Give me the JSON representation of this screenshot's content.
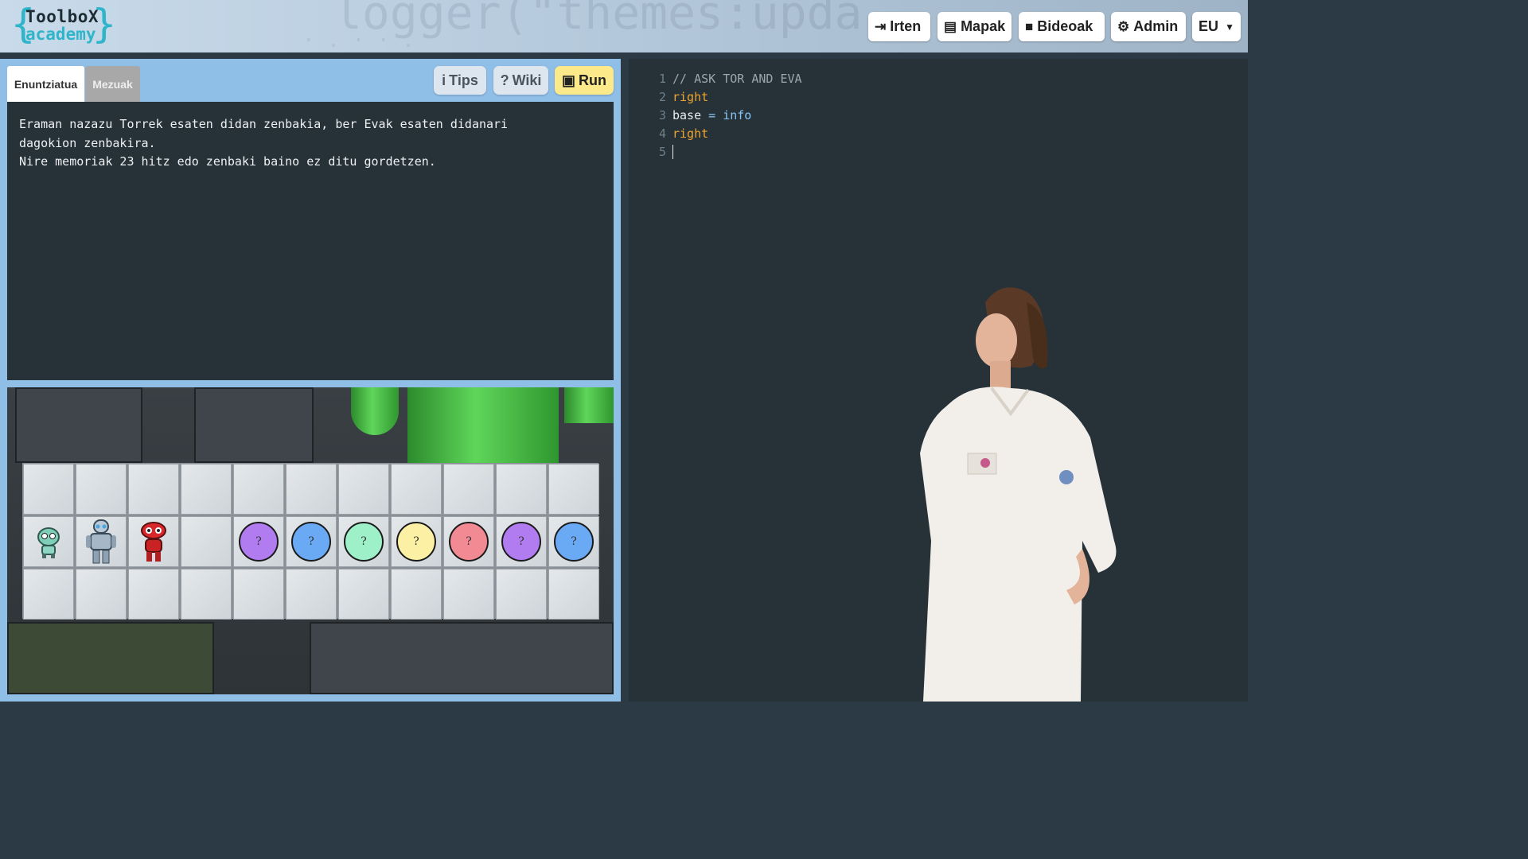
{
  "header": {
    "logo_line1": "ToolboX",
    "logo_line2": "academy",
    "nav": [
      {
        "label": "Irten",
        "icon": "sign-out-icon"
      },
      {
        "label": "Mapak",
        "icon": "table-icon"
      },
      {
        "label": "Bideoak",
        "icon": "video-camera-icon"
      },
      {
        "label": "Admin",
        "icon": "gear-icon"
      }
    ],
    "language": "EU"
  },
  "tabs": {
    "statement": "Enuntziatua",
    "messages": "Mezuak"
  },
  "actions": {
    "tips": "Tips",
    "wiki": "Wiki",
    "run": "Run"
  },
  "statement": {
    "lines": [
      "Eraman nazazu Torrek esaten didan zenbakia, ber Evak esaten didanari\ndagokion zenbakira.",
      "Nire memoriak 23 hitz edo zenbaki baino ez ditu gordetzen."
    ]
  },
  "game": {
    "orbs": [
      {
        "label": "?",
        "color": "#b07cf0"
      },
      {
        "label": "?",
        "color": "#6aa9f4"
      },
      {
        "label": "?",
        "color": "#9df0c8"
      },
      {
        "label": "?",
        "color": "#fbf0a3"
      },
      {
        "label": "?",
        "color": "#f28a94"
      },
      {
        "label": "?",
        "color": "#b07cf0"
      },
      {
        "label": "?",
        "color": "#6aa9f4"
      }
    ]
  },
  "editor": {
    "lines": [
      {
        "n": "1",
        "text": "// ASK TOR AND EVA"
      },
      {
        "n": "2",
        "text": "right"
      },
      {
        "n": "3",
        "var": "base",
        "op": " = ",
        "val": "info"
      },
      {
        "n": "4",
        "text": "right"
      },
      {
        "n": "5",
        "text": ""
      }
    ]
  },
  "colors": {
    "accent": "#2fb5c9",
    "run": "#fbe98a",
    "panel": "#8fbee7",
    "dark": "#263238"
  }
}
